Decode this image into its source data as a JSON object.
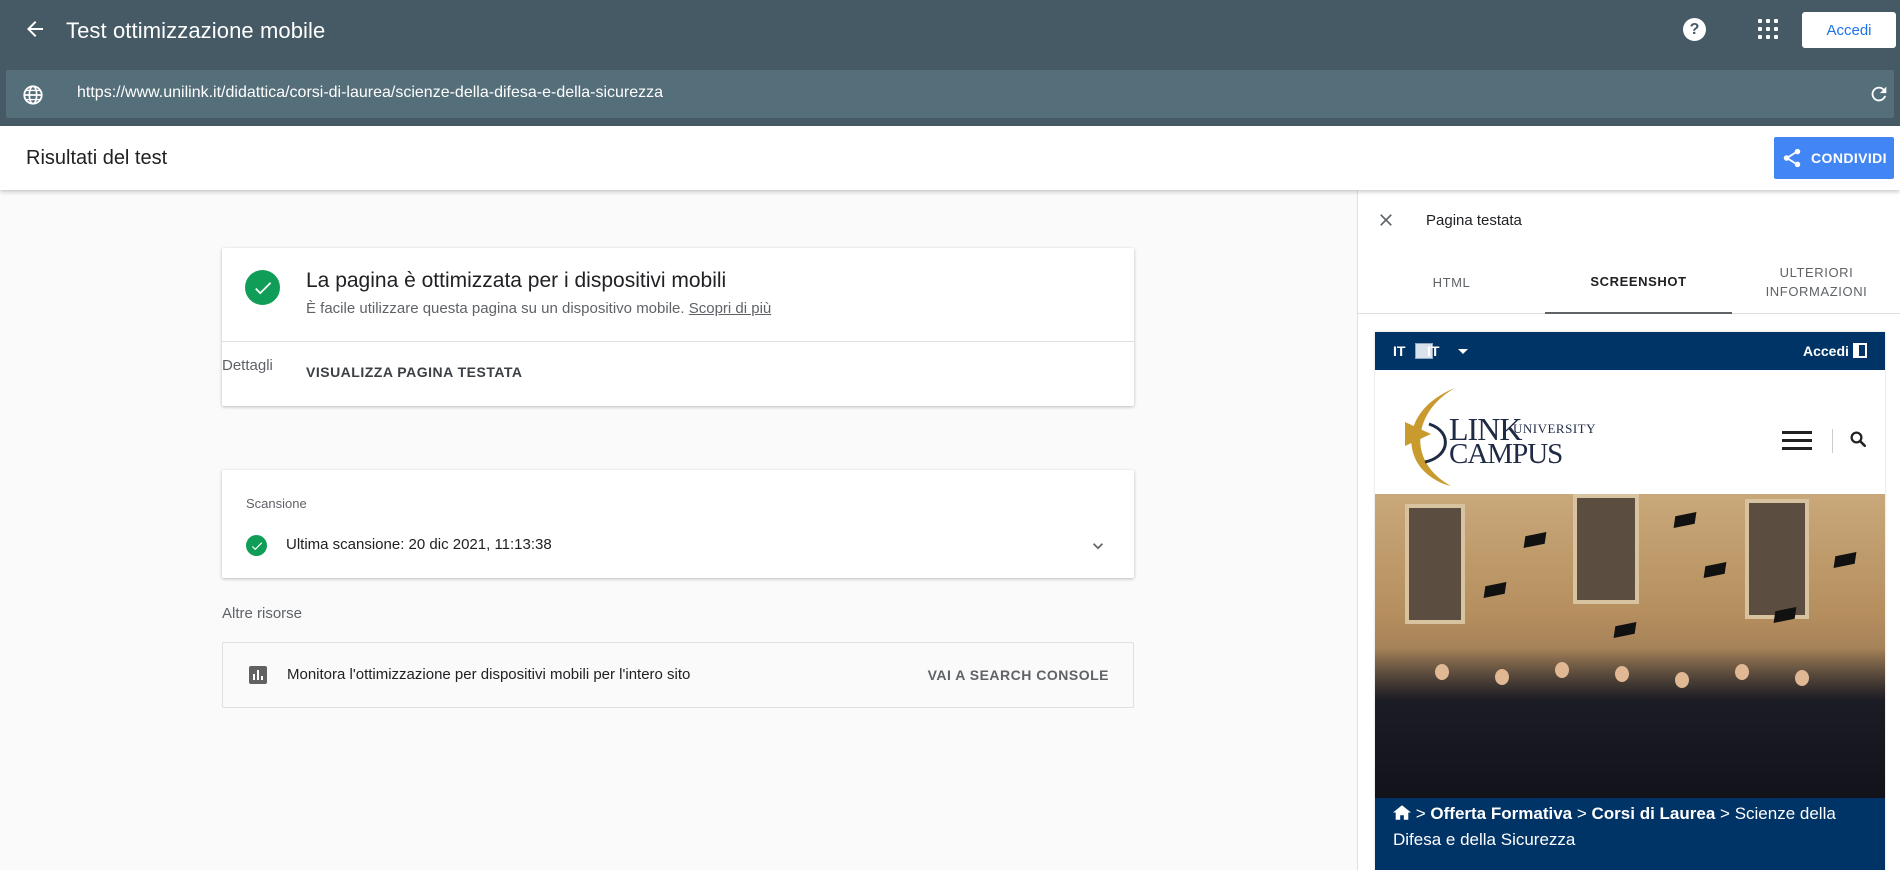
{
  "app": {
    "title": "Test ottimizzazione mobile",
    "signin_label": "Accedi",
    "url": "https://www.unilink.it/didattica/corsi-di-laurea/scienze-della-difesa-e-della-sicurezza"
  },
  "results": {
    "title": "Risultati del test",
    "share_label": "CONDIVIDI"
  },
  "result_card": {
    "title": "La pagina è ottimizzata per i dispositivi mobili",
    "subtitle": "È facile utilizzare questa pagina su un dispositivo mobile.",
    "learn_more": "Scopri di più",
    "view_tested_page": "VISUALIZZA PAGINA TESTATA"
  },
  "details": {
    "heading": "Dettagli",
    "scan_label": "Scansione",
    "last_scan": "Ultima scansione: 20 dic 2021, 11:13:38"
  },
  "resources": {
    "heading": "Altre risorse",
    "text": "Monitora l'ottimizzazione per dispositivi mobili per l'intero sito",
    "link": "VAI A SEARCH CONSOLE"
  },
  "panel": {
    "title": "Pagina testata",
    "tabs": [
      {
        "label": "HTML",
        "active": false
      },
      {
        "label": "SCREENSHOT",
        "active": true
      },
      {
        "label": "ULTERIORI\nINFORMAZIONI",
        "active": false
      }
    ]
  },
  "screenshot": {
    "lang": "IT",
    "lang_alt": "IT",
    "login": "Accedi",
    "logo_line1": "LINK",
    "logo_line2": "CAMPUS",
    "logo_univ": "UNIVERSITY",
    "breadcrumb": {
      "sep": ">",
      "item1": "Offerta Formativa",
      "item2": "Corsi di Laurea",
      "current": "Scienze della Difesa e della Sicurezza"
    }
  },
  "colors": {
    "topbar": "#455a64",
    "urlbar": "#546e7a",
    "accent_blue": "#4285f4",
    "success_green": "#0f9d58",
    "site_navy": "#003366"
  }
}
